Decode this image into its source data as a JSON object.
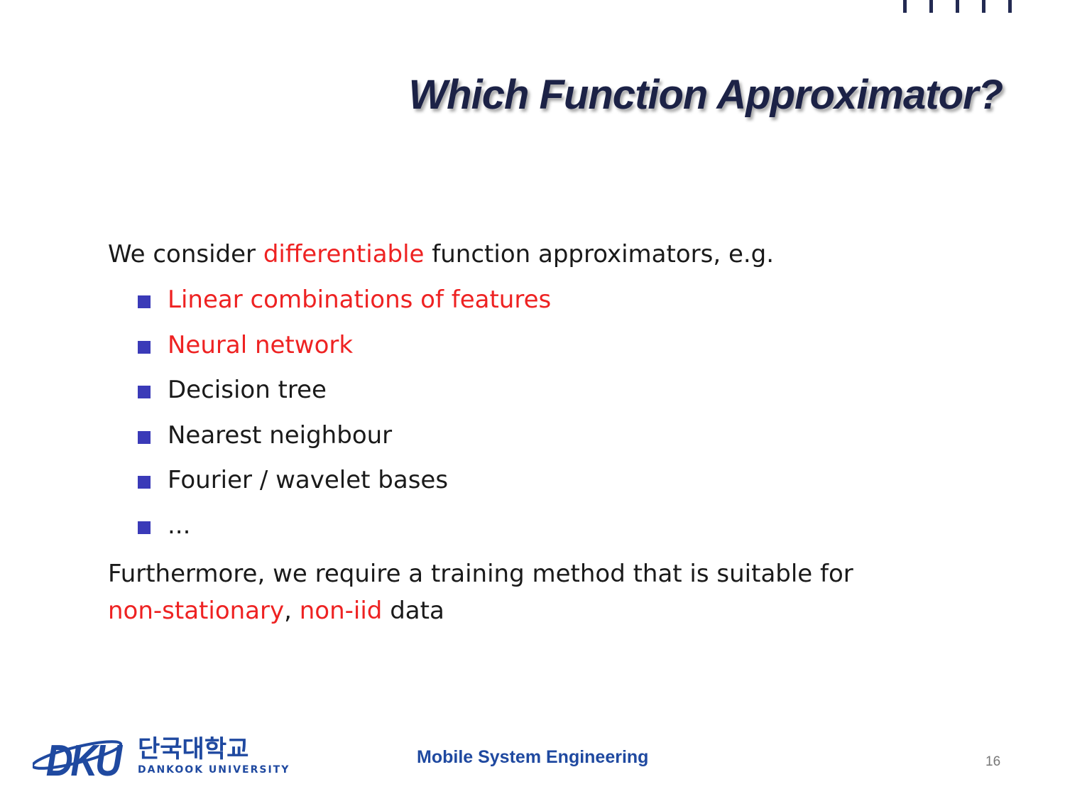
{
  "slide": {
    "title": "Which Function Approximator?",
    "intro": {
      "before": "We consider ",
      "highlight": "differentiable",
      "after": " function approximators, e.g."
    },
    "items": [
      {
        "label": "Linear combinations of features",
        "highlight": true
      },
      {
        "label": "Neural network",
        "highlight": true
      },
      {
        "label": "Decision tree",
        "highlight": false
      },
      {
        "label": "Nearest neighbour",
        "highlight": false
      },
      {
        "label": "Fourier / wavelet bases",
        "highlight": false
      },
      {
        "label": "...",
        "highlight": false
      }
    ],
    "further": {
      "line1": "Furthermore, we require a training method that is suitable for",
      "highlight1": "non-stationary",
      "sep": ", ",
      "highlight2": "non-iid",
      "tail": " data"
    }
  },
  "footer": {
    "logo_mark": "DKU",
    "logo_korean": "단국대학교",
    "logo_english": "DANKOOK UNIVERSITY",
    "course": "Mobile System Engineering",
    "page_number": "16"
  },
  "colors": {
    "highlight": "#ee2222",
    "bullet": "#3a3ab8",
    "title": "#1c2246",
    "footer_blue": "#1f49a0"
  }
}
